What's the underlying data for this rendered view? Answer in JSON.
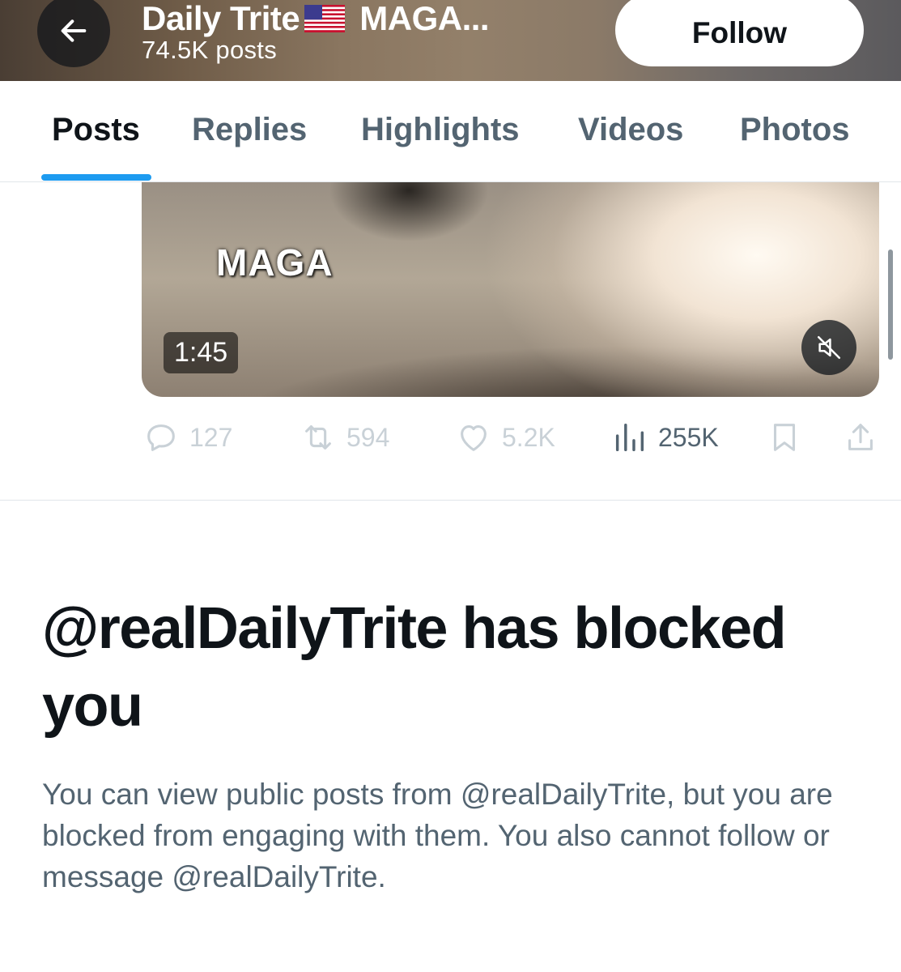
{
  "header": {
    "title_prefix": "Daily Trite",
    "flag_icon": "us-flag-emoji",
    "title_suffix": "MAGA...",
    "post_count": "74.5K posts",
    "follow_label": "Follow"
  },
  "tabs": [
    {
      "label": "Posts",
      "active": true
    },
    {
      "label": "Replies",
      "active": false
    },
    {
      "label": "Highlights",
      "active": false
    },
    {
      "label": "Videos",
      "active": false
    },
    {
      "label": "Photos",
      "active": false
    }
  ],
  "colors": {
    "accent": "#1d9bf0",
    "text_primary": "#0f1419",
    "text_secondary": "#536471",
    "disabled": "#c9d1d7"
  },
  "post": {
    "video_caption": "MAGA",
    "duration": "1:45",
    "mute_icon": "speaker-muted-icon",
    "actions": {
      "replies": "127",
      "reposts": "594",
      "likes": "5.2K",
      "views": "255K"
    }
  },
  "blocked": {
    "title": "@realDailyTrite has blocked you",
    "message": "You can view public posts from @realDailyTrite, but you are blocked from engaging with them. You also cannot follow or message @realDailyTrite."
  }
}
